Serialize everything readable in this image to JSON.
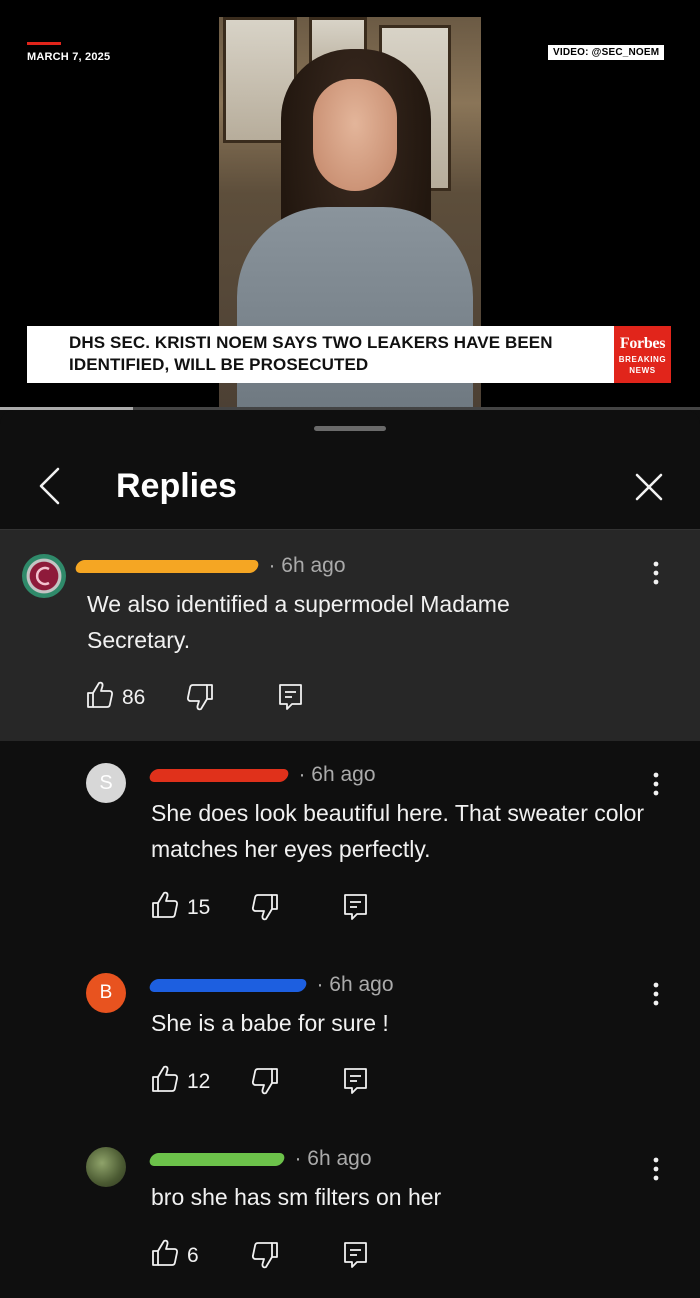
{
  "video": {
    "date": "MARCH 7, 2025",
    "credit": "VIDEO: @SEC_NOEM",
    "headline": "DHS SEC. KRISTI NOEM SAYS TWO LEAKERS HAVE BEEN IDENTIFIED, WILL BE PROSECUTED",
    "brand": "Forbes",
    "brand_sub_1": "BREAKING",
    "brand_sub_2": "NEWS",
    "progress_fraction": 0.19
  },
  "sheet": {
    "title": "Replies"
  },
  "comments": [
    {
      "avatar_letter": "",
      "time": "· 6h ago",
      "text": "We also identified a supermodel Madame Secretary.",
      "likes": "86"
    },
    {
      "avatar_letter": "S",
      "time": "· 6h ago",
      "text": "She does look beautiful here. That sweater color matches her eyes perfectly.",
      "likes": "15"
    },
    {
      "avatar_letter": "B",
      "time": "· 6h ago",
      "text": "She is a babe for sure !",
      "likes": "12"
    },
    {
      "avatar_letter": "",
      "time": "· 6h ago",
      "text": "bro she has sm filters on her",
      "likes": "6"
    }
  ],
  "colors": {
    "redaction_1": "#f5a623",
    "redaction_2": "#e0311b",
    "redaction_3": "#1d5fe0",
    "redaction_4": "#6cc24a",
    "avatar_s": "#d7d7d7",
    "avatar_b": "#e8531f"
  },
  "icons": [
    "chevron-left-icon",
    "close-icon",
    "thumb-up-icon",
    "thumb-down-icon",
    "reply-icon",
    "more-vert-icon"
  ]
}
